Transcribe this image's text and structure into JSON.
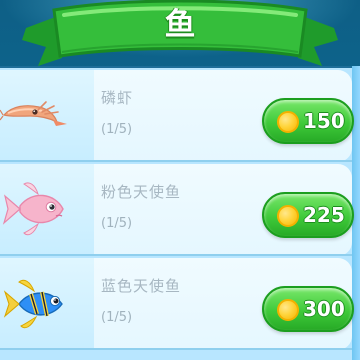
{
  "title": "鱼",
  "items": [
    {
      "name": "磷虾",
      "owned": "(1/5)",
      "price": "150",
      "icon": "krill-shrimp-icon"
    },
    {
      "name": "粉色天使鱼",
      "owned": "(1/5)",
      "price": "225",
      "icon": "pink-angelfish-icon"
    },
    {
      "name": "蓝色天使鱼",
      "owned": "(1/5)",
      "price": "300",
      "icon": "blue-angelfish-icon"
    }
  ],
  "colors": {
    "panel": "#b8e6ff",
    "button": "#3fca3a",
    "coin": "#ffd53d",
    "banner": "#34b93a"
  }
}
